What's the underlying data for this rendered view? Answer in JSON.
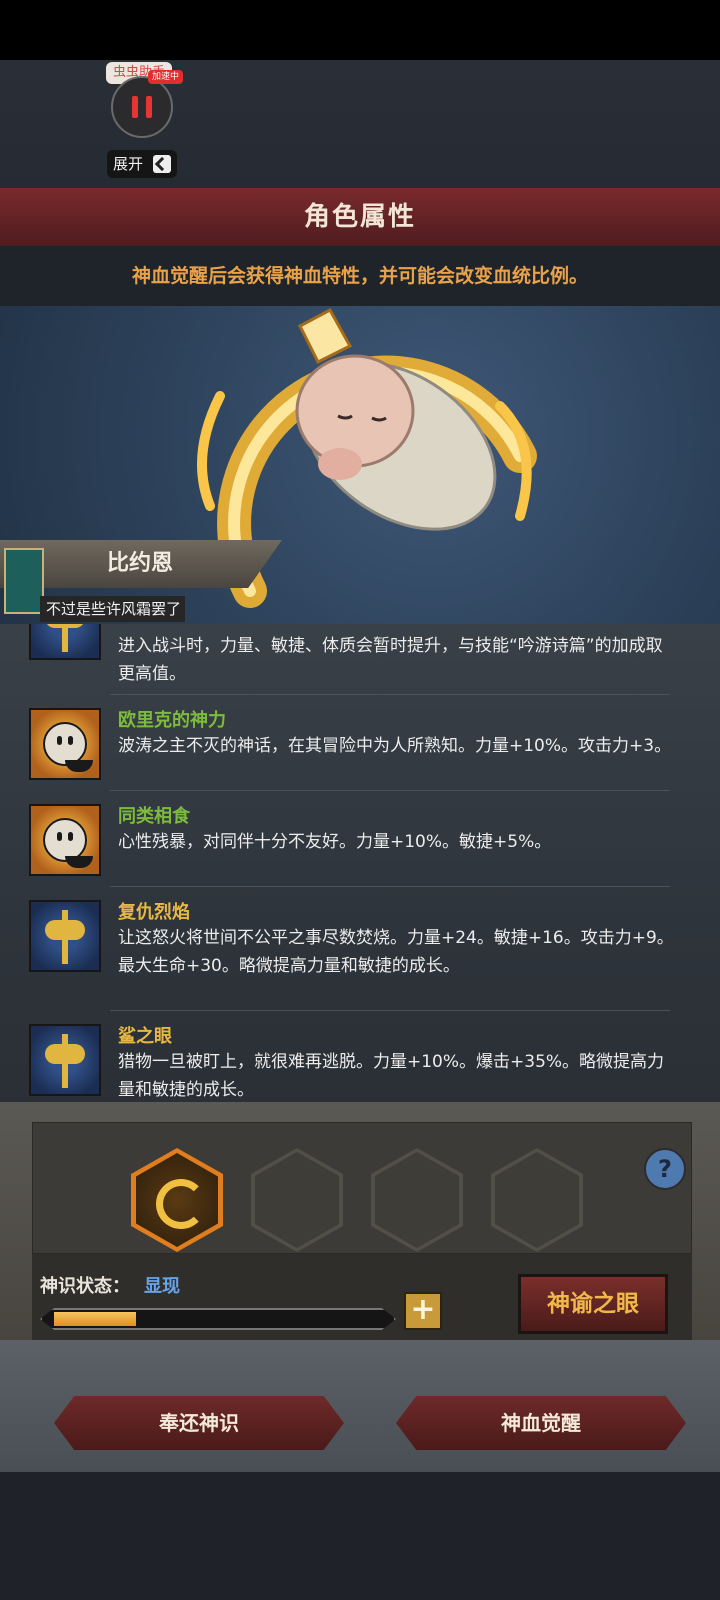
{
  "overlay": {
    "app_label": "虫虫助手",
    "badge": "加速中",
    "expand_label": "展开"
  },
  "header": {
    "title": "角色属性",
    "subtitle": "神血觉醒后会获得神血特性，并可能会改变血统比例。"
  },
  "hero": {
    "name": "比约恩",
    "quote": "不过是些许风霜罢了"
  },
  "traits": [
    {
      "icon": "axe-icon",
      "name": "",
      "name_color": "#e8b842",
      "desc": "进入战斗时，力量、敏捷、体质会暂时提升，与技能“吟游诗篇”的加成取更高值。"
    },
    {
      "icon": "smile-icon",
      "name": "欧里克的神力",
      "name_color": "#7dbb3d",
      "desc": "波涛之主不灭的神话，在其冒险中为人所熟知。力量+10%。攻击力+3。"
    },
    {
      "icon": "smile-icon",
      "name": "同类相食",
      "name_color": "#7dbb3d",
      "desc": "心性残暴，对同伴十分不友好。力量+10%。敏捷+5%。"
    },
    {
      "icon": "axe-icon",
      "name": "复仇烈焰",
      "name_color": "#e8b842",
      "desc": "让这怒火将世间不公平之事尽数焚烧。力量+24。敏捷+16。攻击力+9。最大生命+30。略微提高力量和敏捷的成长。"
    },
    {
      "icon": "axe-icon",
      "name": "鲨之眼",
      "name_color": "#e8b842",
      "desc": "猎物一旦被盯上，就很难再逃脱。力量+10%。爆击+35%。略微提高力量和敏捷的成长。"
    }
  ],
  "divine": {
    "status_label": "神识状态：",
    "status_value": "显现",
    "progress": 0.25,
    "plus_label": "+",
    "oracle_label": "神谕之眼",
    "help_label": "?"
  },
  "footer": {
    "return_label": "奉还神识",
    "awaken_label": "神血觉醒"
  }
}
